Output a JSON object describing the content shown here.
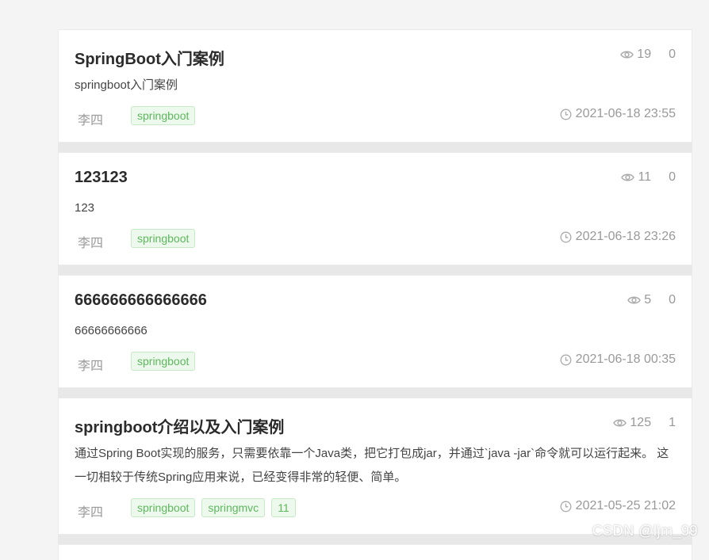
{
  "posts": [
    {
      "title": "SpringBoot入门案例",
      "summary": "springboot入门案例",
      "views": "19",
      "comments": "0",
      "author": "李四",
      "tags": [
        "springboot"
      ],
      "date": "2021-06-18 23:55"
    },
    {
      "title": "123123",
      "summary": "123",
      "views": "11",
      "comments": "0",
      "author": "李四",
      "tags": [
        "springboot"
      ],
      "date": "2021-06-18 23:26"
    },
    {
      "title": "666666666666666",
      "summary": "66666666666",
      "views": "5",
      "comments": "0",
      "author": "李四",
      "tags": [
        "springboot"
      ],
      "date": "2021-06-18 00:35"
    },
    {
      "title": "springboot介绍以及入门案例",
      "summary": "通过Spring Boot实现的服务，只需要依靠一个Java类，把它打包成jar，并通过`java -jar`命令就可以运行起来。 这一切相较于传统Spring应用来说，已经变得非常的轻便、简单。",
      "views": "125",
      "comments": "1",
      "author": "李四",
      "tags": [
        "springboot",
        "springmvc",
        "11"
      ],
      "date": "2021-05-25 21:02"
    }
  ],
  "watermark": "CSDN @ljm_99"
}
